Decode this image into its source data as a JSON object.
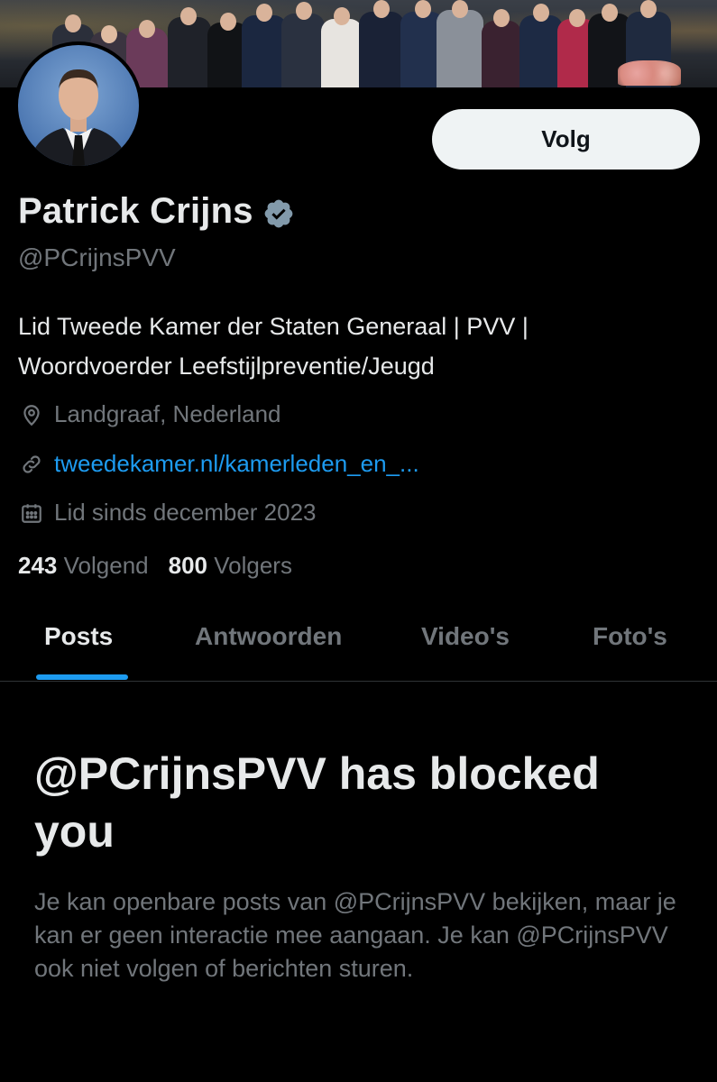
{
  "profile": {
    "display_name": "Patrick Crijns",
    "handle": "@PCrijnsPVV",
    "bio_line1": "Lid Tweede Kamer der Staten Generaal | PVV |",
    "bio_line2": "Woordvoerder Leefstijlpreventie/Jeugd",
    "location": "Landgraaf, Nederland",
    "website": "tweedekamer.nl/kamerleden_en_...",
    "joined": "Lid sinds december 2023",
    "following_count": "243",
    "following_label": "Volgend",
    "followers_count": "800",
    "followers_label": "Volgers",
    "verified_icon": "verified-badge-icon"
  },
  "actions": {
    "follow_label": "Volg"
  },
  "tabs": [
    {
      "label": "Posts",
      "active": true
    },
    {
      "label": "Antwoorden",
      "active": false
    },
    {
      "label": "Video's",
      "active": false
    },
    {
      "label": "Foto's",
      "active": false
    }
  ],
  "blocked": {
    "title": "@PCrijnsPVV has blocked you",
    "description": "Je kan openbare posts van @PCrijnsPVV bekijken, maar je kan er geen interactie mee aangaan. Je kan @PCrijnsPVV ook niet volgen of berichten sturen."
  },
  "colors": {
    "background": "#000000",
    "text_primary": "#e7e9ea",
    "text_secondary": "#71767b",
    "accent": "#1d9bf0",
    "button_bg": "#eff3f4"
  },
  "icons": {
    "location": "location-pin-icon",
    "link": "link-icon",
    "calendar": "calendar-icon"
  }
}
